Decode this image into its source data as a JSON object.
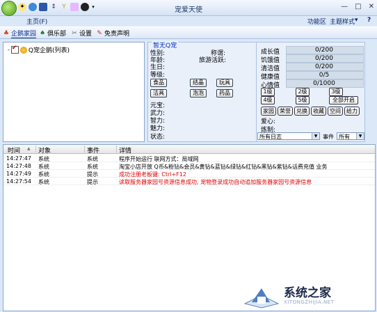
{
  "window": {
    "title": "宠爱天使",
    "min": "—",
    "max": "□",
    "close": "✕"
  },
  "menubar": {
    "home": "主页(F)",
    "function_area": "功能区",
    "theme": "主题样式",
    "arrow": "▾"
  },
  "navbar": {
    "items": [
      "企鹅家园",
      "俱乐部",
      "设置",
      "免责声明"
    ]
  },
  "tree": {
    "root": "Q宠企鹅(列表)",
    "expander": "-"
  },
  "pet": {
    "name": "暂无Q宠",
    "labels": {
      "gender": "性别:",
      "title": "称谓:",
      "age": "年龄:",
      "travel": "旅游活跃:",
      "birthday": "生日:",
      "level": "等级:",
      "yuanbao": "元宝:",
      "force": "武力:",
      "wisdom": "智力:",
      "charm": "魅力:",
      "status": "状态:"
    },
    "buttons": {
      "food": "食品",
      "crystal": "结晶",
      "toy": "玩具",
      "clean": "洁具",
      "bubble": "泡泡",
      "medicine": "药品"
    }
  },
  "stats": {
    "rows": [
      {
        "label": "成长值",
        "value": "0/200"
      },
      {
        "label": "饥饿值",
        "value": "0/200"
      },
      {
        "label": "清洁值",
        "value": "0/200"
      },
      {
        "label": "健康值",
        "value": "0/5"
      },
      {
        "label": "心情值",
        "value": "0/1000"
      }
    ],
    "levels": [
      "1级",
      "2级",
      "3级",
      "4级",
      "5级",
      "全部开启"
    ],
    "actions": [
      "家园",
      "荣誉",
      "兑换",
      "收藏",
      "空间",
      "给力"
    ],
    "love_label": "爱心:",
    "practice_label": "炼制:",
    "filter": {
      "log_select": "所有日志",
      "event_label": "事件",
      "event_select": "所有",
      "dropdown": "▼"
    }
  },
  "log": {
    "headers": [
      "时间",
      "对象",
      "事件",
      "详情"
    ],
    "sort_arrow": "▲",
    "rows": [
      {
        "time": "14:27:47",
        "object": "系统",
        "event": "系统",
        "detail": "程序开始运行 联网方式：局域网",
        "highlight": false
      },
      {
        "time": "14:27:48",
        "object": "系统",
        "event": "系统",
        "detail": "淘宝小店开放 Q币&粉钻&会员&黄钻&蓝钻&绿钻&红钻&黑钻&紫钻&话费充值 业务",
        "highlight": false
      },
      {
        "time": "14:27:49",
        "object": "系统",
        "event": "提示",
        "detail": "成功注册老板键: Ctrl+F12",
        "highlight": true
      },
      {
        "time": "14:27:54",
        "object": "系统",
        "event": "提示",
        "detail": "读取服务器家园号资源信息成功, 宠物登录成功自动追加服务器家园号资源信息",
        "highlight": true
      }
    ]
  },
  "watermark": {
    "text": "系统之家",
    "url": "XITONGZHIJIA.NET"
  },
  "colors": {
    "accent": "#0b2f8a",
    "highlight_text": "#e00000",
    "pet_name": "#0030c0"
  }
}
